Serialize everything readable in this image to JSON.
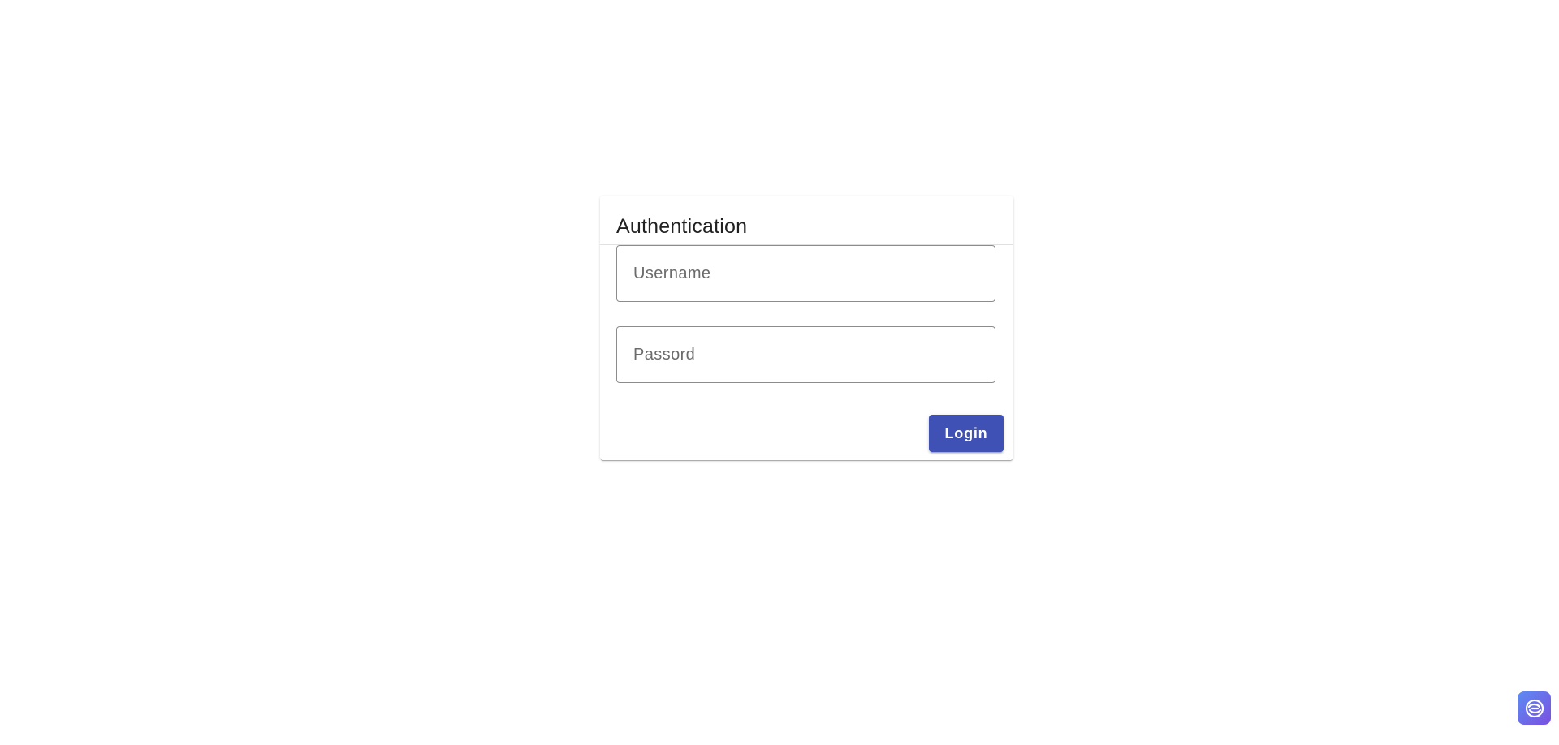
{
  "auth": {
    "title": "Authentication",
    "username": {
      "value": "",
      "placeholder": "Username"
    },
    "password": {
      "value": "",
      "placeholder": "Passord"
    },
    "login_label": "Login"
  },
  "colors": {
    "primary": "#3f51b5",
    "badge_start": "#5b8cf2",
    "badge_end": "#7b4fe0"
  },
  "badge": {
    "icon": "assistant-icon"
  }
}
